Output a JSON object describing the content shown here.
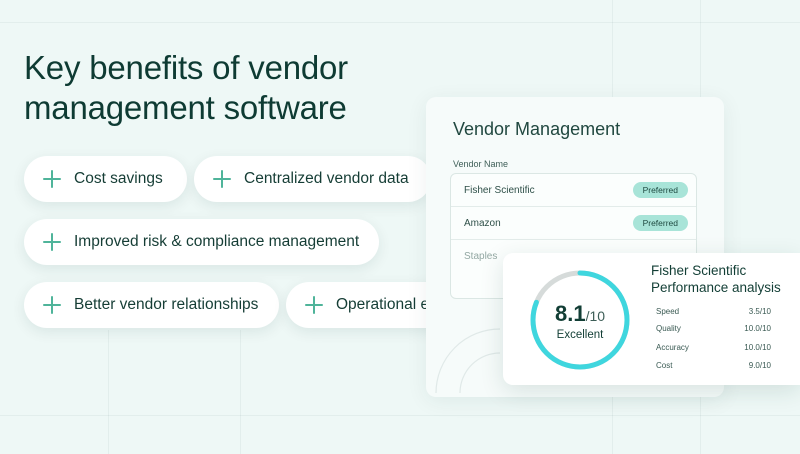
{
  "headline": {
    "line1": "Key benefits of vendor",
    "line2": "management software"
  },
  "benefits": [
    {
      "label": "Cost savings",
      "icon": "plus-icon"
    },
    {
      "label": "Centralized vendor data",
      "icon": "plus-icon"
    },
    {
      "label": "Improved risk & compliance management",
      "icon": "plus-icon"
    },
    {
      "label": "Better vendor relationships",
      "icon": "plus-icon"
    },
    {
      "label": "Operational efficiency",
      "icon": "plus-icon"
    }
  ],
  "vendor_card": {
    "title": "Vendor Management",
    "column_header": "Vendor Name",
    "rows": [
      {
        "name": "Fisher Scientific",
        "status": "Preferred"
      },
      {
        "name": "Amazon",
        "status": "Preferred"
      },
      {
        "name": "Staples",
        "status": ""
      }
    ]
  },
  "performance_card": {
    "title_line1": "Fisher Scientific",
    "title_line2": "Performance analysis",
    "score": "8.1",
    "score_suffix": "/10",
    "score_fraction": 0.81,
    "rating": "Excellent",
    "metrics": [
      {
        "label": "Speed",
        "value": "3.5/10"
      },
      {
        "label": "Quality",
        "value": "10.0/10"
      },
      {
        "label": "Accuracy",
        "value": "10.0/10"
      },
      {
        "label": "Cost",
        "value": "9.0/10"
      }
    ]
  },
  "colors": {
    "background": "#eef8f6",
    "text": "#0e3b33",
    "accent": "#4fb49a",
    "ring": "#3fd6de",
    "badge": "#a8e4d8"
  }
}
